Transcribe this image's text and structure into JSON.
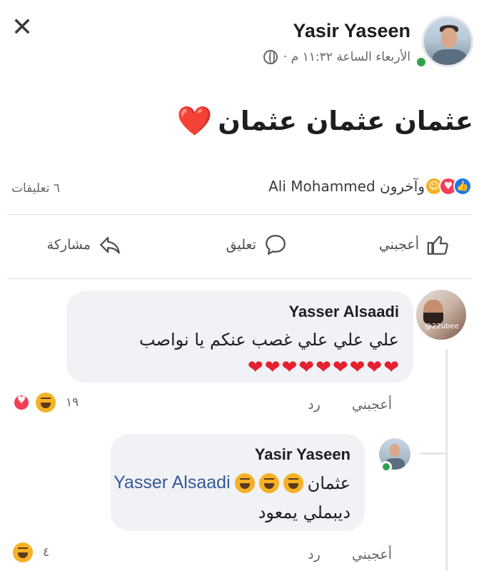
{
  "header": {
    "close_glyph": "✕",
    "author": "Yasir Yaseen",
    "timestamp": "الأربعاء الساعة ١١:٣٢ م ·",
    "privacy_icon": "globe-icon"
  },
  "post": {
    "text": "عثمان عثمان عثمان",
    "emoji": "❤️"
  },
  "reactions": {
    "summary": "Ali Mohammed وآخرون",
    "comments_count": "٦ تعليقات",
    "icons": [
      "like-icon",
      "love-icon",
      "care-icon"
    ]
  },
  "actions": {
    "like": "أعجبني",
    "comment": "تعليق",
    "share": "مشاركة"
  },
  "comments": [
    {
      "author": "Yasser Alsaadi",
      "text": "علي علي علي غصب عنكم يا نواصب",
      "hearts": "❤❤❤❤❤❤❤❤❤",
      "avatar_tag": "@22ubee",
      "like_label": "أعجبني",
      "reply_label": "رد",
      "reaction_count": "١٩"
    },
    {
      "author": "Yasir Yaseen",
      "text_word": "عثمان",
      "mention": "Yasser Alsaadi",
      "second_line": "ديبملي يمعود",
      "like_label": "أعجبني",
      "reply_label": "رد",
      "reaction_count": "٤"
    }
  ],
  "colors": {
    "link": "#385898",
    "like_blue": "#1877f2",
    "love_red": "#f33e58",
    "haha_yellow": "#f7b125",
    "online_green": "#31a24c",
    "bubble_bg": "#f0f2f5"
  }
}
